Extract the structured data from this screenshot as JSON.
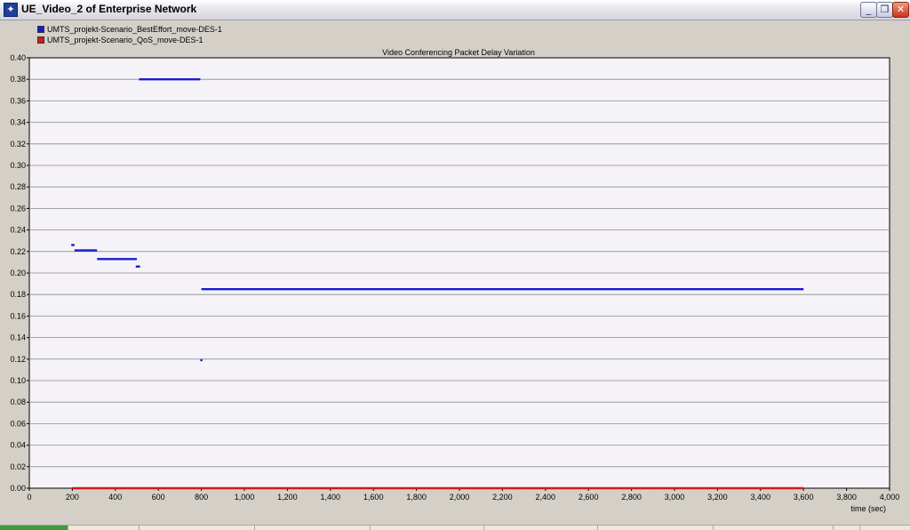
{
  "window": {
    "title": "UE_Video_2 of Enterprise Network",
    "icon": "app-icon",
    "controls": [
      "minimize-icon",
      "restore-icon",
      "close-icon"
    ]
  },
  "legend": [
    {
      "name": "UMTS_projekt-Scenario_BestEffort_move-DES-1",
      "color": "#1a1ad2"
    },
    {
      "name": "UMTS_projekt-Scenario_QoS_move-DES-1",
      "color": "#d21a1a"
    }
  ],
  "chart_data": {
    "type": "line",
    "title": "Video Conferencing Packet Delay Variation",
    "xlabel": "time (sec)",
    "ylabel": "",
    "xlim": [
      0,
      4000
    ],
    "ylim": [
      0,
      0.4
    ],
    "x_ticks": [
      0,
      200,
      400,
      600,
      800,
      1000,
      1200,
      1400,
      1600,
      1800,
      2000,
      2200,
      2400,
      2600,
      2800,
      3000,
      3200,
      3400,
      3600,
      3800,
      4000
    ],
    "x_tick_labels": [
      "0",
      "200",
      "400",
      "600",
      "800",
      "1,000",
      "1,200",
      "1,400",
      "1,600",
      "1,800",
      "2,000",
      "2,200",
      "2,400",
      "2,600",
      "2,800",
      "3,000",
      "3,200",
      "3,400",
      "3,600",
      "3,800",
      "4,000"
    ],
    "y_ticks": [
      0,
      0.02,
      0.04,
      0.06,
      0.08,
      0.1,
      0.12,
      0.14,
      0.16,
      0.18,
      0.2,
      0.22,
      0.24,
      0.26,
      0.28,
      0.3,
      0.32,
      0.34,
      0.36,
      0.38,
      0.4
    ],
    "y_tick_labels": [
      "0.00",
      "0.02",
      "0.04",
      "0.06",
      "0.08",
      "0.10",
      "0.12",
      "0.14",
      "0.16",
      "0.18",
      "0.20",
      "0.22",
      "0.24",
      "0.26",
      "0.28",
      "0.30",
      "0.32",
      "0.34",
      "0.36",
      "0.38",
      "0.40"
    ],
    "grid": true,
    "series": [
      {
        "name": "UMTS_projekt-Scenario_BestEffort_move-DES-1",
        "color": "#1a1ad2",
        "segments": [
          {
            "x": [
              195,
              210
            ],
            "y": 0.226
          },
          {
            "x": [
              210,
              315
            ],
            "y": 0.221
          },
          {
            "x": [
              315,
              500
            ],
            "y": 0.213
          },
          {
            "x": [
              495,
              515
            ],
            "y": 0.206
          },
          {
            "x": [
              510,
              795
            ],
            "y": 0.38
          },
          {
            "x": [
              795,
              805
            ],
            "y": 0.119
          },
          {
            "x": [
              800,
              3600
            ],
            "y": 0.185
          }
        ]
      },
      {
        "name": "UMTS_projekt-Scenario_QoS_move-DES-1",
        "color": "#d21a1a",
        "segments": [
          {
            "x": [
              200,
              3600
            ],
            "y": 0.0
          }
        ]
      }
    ]
  }
}
